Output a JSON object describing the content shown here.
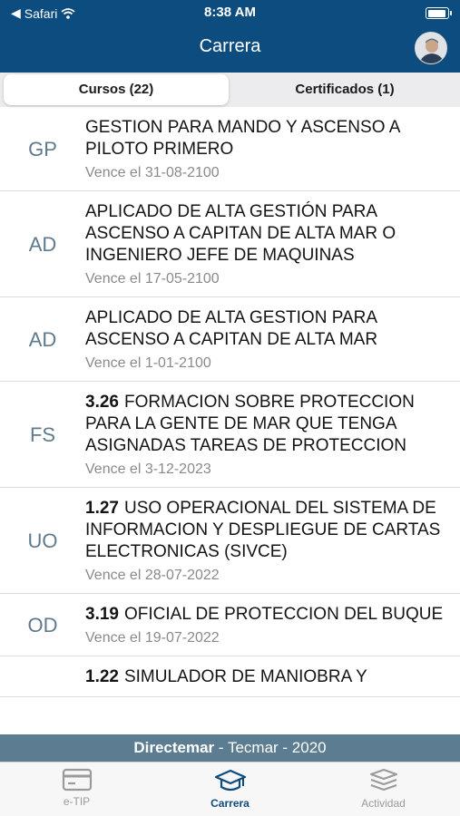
{
  "status_bar": {
    "back_app": "Safari",
    "time": "8:38 AM"
  },
  "nav": {
    "title": "Carrera"
  },
  "segments": [
    {
      "label": "Cursos (22)",
      "active": true
    },
    {
      "label": "Certificados (1)",
      "active": false
    }
  ],
  "courses": [
    {
      "abbr": "GP",
      "code": "",
      "title": "GESTION PARA MANDO Y ASCENSO A PILOTO PRIMERO",
      "due": "Vence el 31-08-2100"
    },
    {
      "abbr": "AD",
      "code": "",
      "title": "APLICADO DE ALTA GESTIÓN PARA ASCENSO A CAPITAN DE ALTA MAR O INGENIERO JEFE DE MAQUINAS",
      "due": "Vence el 17-05-2100"
    },
    {
      "abbr": "AD",
      "code": "",
      "title": "APLICADO DE ALTA GESTION PARA ASCENSO A CAPITAN DE ALTA MAR",
      "due": "Vence el 1-01-2100"
    },
    {
      "abbr": "FS",
      "code": "3.26",
      "title": "FORMACION SOBRE PROTECCION PARA LA GENTE DE MAR QUE TENGA ASIGNADAS TAREAS DE PROTECCION",
      "due": "Vence el 3-12-2023"
    },
    {
      "abbr": "UO",
      "code": "1.27",
      "title": "USO OPERACIONAL DEL SISTEMA DE INFORMACION Y DESPLIEGUE DE CARTAS ELECTRONICAS (SIVCE)",
      "due": "Vence el 28-07-2022"
    },
    {
      "abbr": "OD",
      "code": "3.19",
      "title": "OFICIAL DE PROTECCION DEL BUQUE",
      "due": "Vence el 19-07-2022"
    },
    {
      "abbr": "",
      "code": "1.22",
      "title": "SIMULADOR DE MANIOBRA Y",
      "due": ""
    }
  ],
  "footer": {
    "org": "Directemar",
    "rest": " - Tecmar - 2020"
  },
  "tabs": [
    {
      "label": "e-TIP",
      "icon": "card-icon",
      "active": false
    },
    {
      "label": "Carrera",
      "icon": "graduation-cap-icon",
      "active": true
    },
    {
      "label": "Actividad",
      "icon": "layers-icon",
      "active": false
    }
  ],
  "colors": {
    "primary": "#0d4c7e",
    "footer_band": "#5c7d91",
    "abbr": "#5f7a8d"
  }
}
